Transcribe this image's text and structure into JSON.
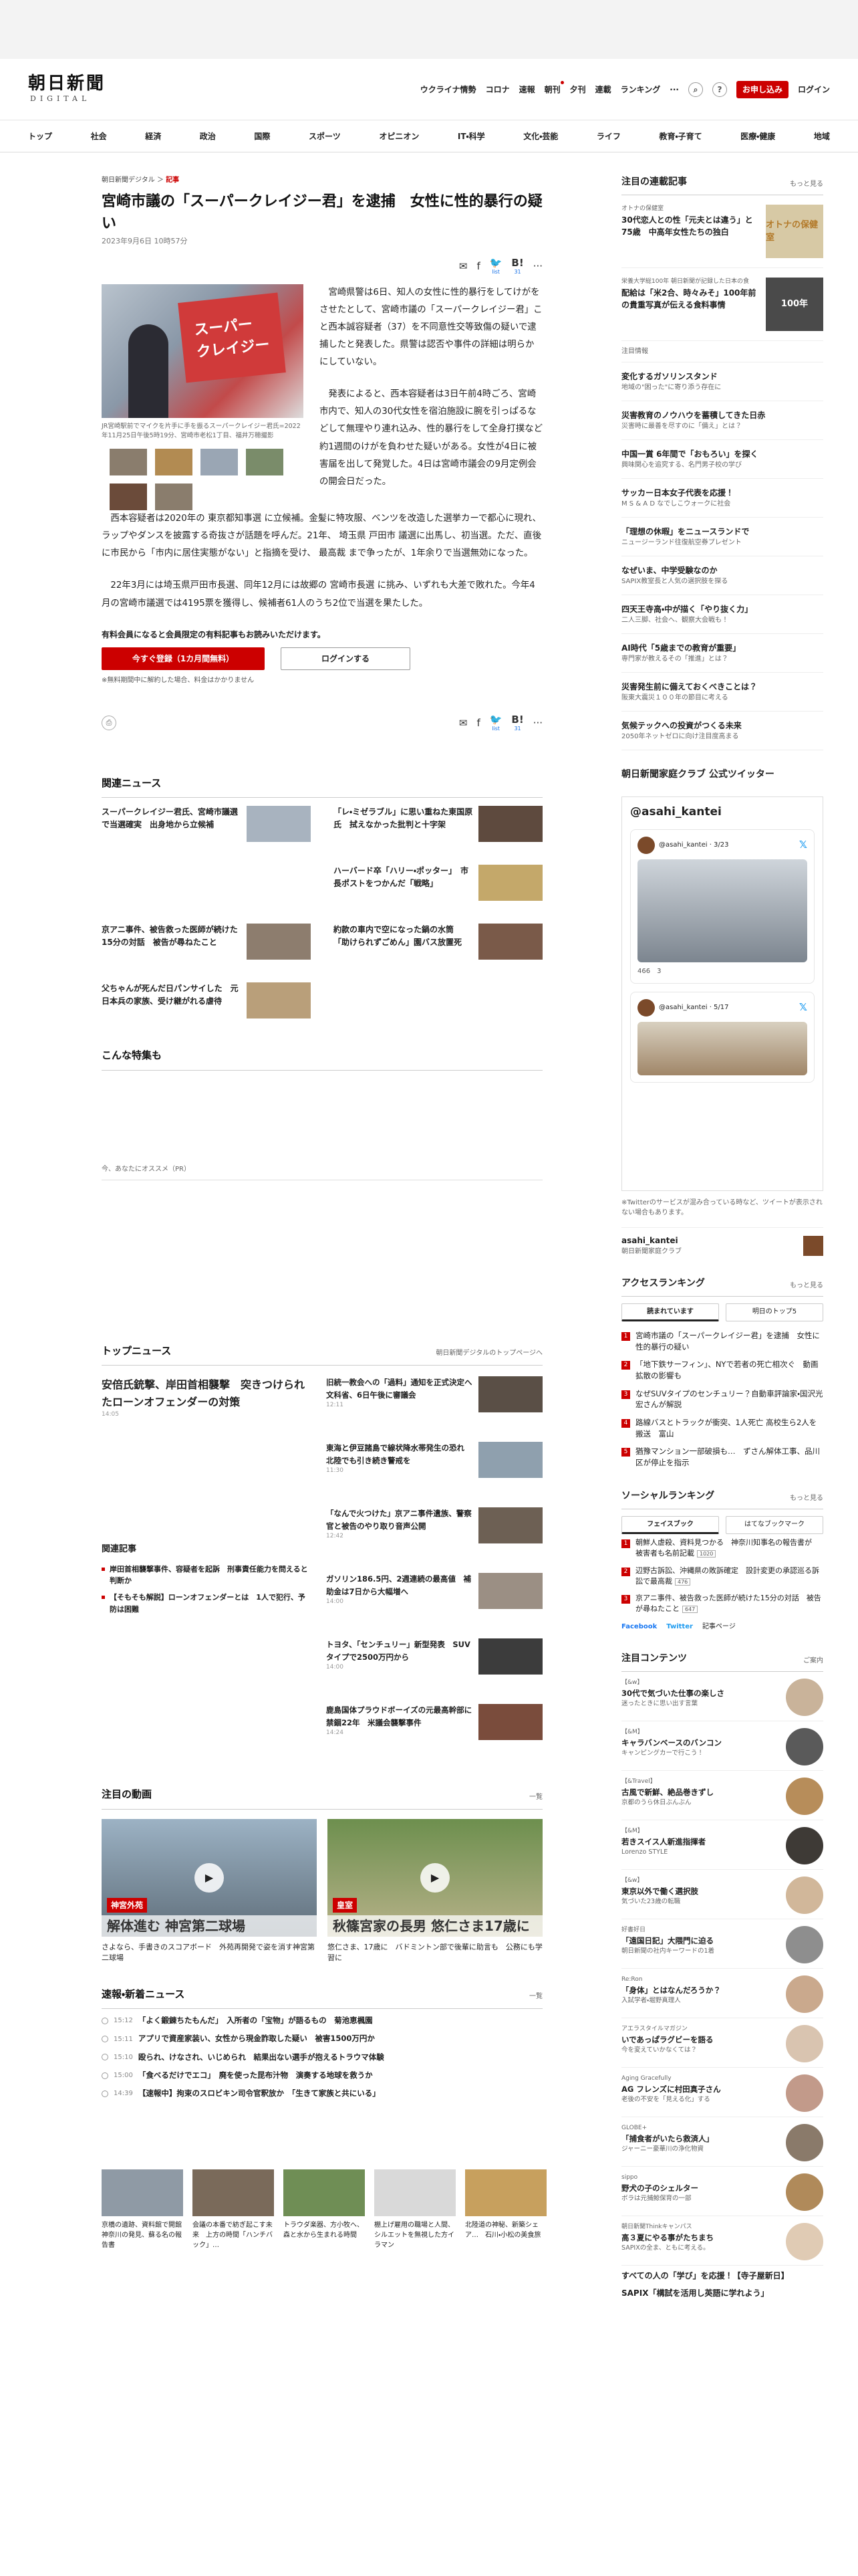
{
  "header": {
    "logo": "朝日新聞",
    "logo_sub": "DIGITAL",
    "nav": [
      "ウクライナ情勢",
      "コロナ",
      "速報",
      "朝刊",
      "夕刊",
      "連載",
      "ランキング"
    ],
    "more": "···",
    "subscribe": "お申し込み",
    "login": "ログイン"
  },
  "categories": [
    "トップ",
    "社会",
    "経済",
    "政治",
    "国際",
    "スポーツ",
    "オピニオン",
    "IT・科学",
    "文化・芸能",
    "ライフ",
    "教育・子育て",
    "医療・健康",
    "地域"
  ],
  "article": {
    "breadcrumb": [
      "朝日新聞デジタル",
      "記事"
    ],
    "title": "宮崎市議の「スーパークレイジー君」を逮捕　女性に性的暴行の疑い",
    "date": "2023年9月6日 10時57分",
    "share": {
      "list": "list",
      "count": "31"
    },
    "photo_caption": "JR宮崎駅前でマイクを片手に手を振るスーパークレイジー君氏=2022年11月25日午後5時19分、宮崎市老松1丁目、福井万穂撮影",
    "paragraphs_side": [
      "宮崎県警は6日、知人の女性に性的暴行をしてけがをさせたとして、宮崎市議の「スーパークレイジー君」こと西本誠容疑者（37）を不同意性交等致傷の疑いで逮捕したと発表した。県警は認否や事件の詳細は明らかにしていない。",
      "発表によると、西本容疑者は3日午前4時ごろ、宮崎市内で、知人の30代女性を宿泊施設に腕を引っぱるなどして無理やり連れ込み、性的暴行をして全身打撲など約1週間のけがを負わせた疑いがある。女性が4日に被害届を出して発覚した。4日は宮崎市議会の9月定例会の開会日だった。",
      "西本容疑者は2020年の 東京都知事選 に立候補。金髪に特攻服、ベンツを改造した選挙カーで都心に現れ、ラップやダンスを披露する奇抜さが話題を呼んだ。21年、 埼玉県 戸田市 議選に出馬し、初当選。ただ、直後に市民から「市内に居住実態がない」と指摘を受け、 最高裁 まで争ったが、1年余りで当選無効になった。"
    ],
    "paragraphs_full": [
      "22年3月には埼玉県戸田市長選、同年12月には故郷の 宮崎市長選 に挑み、いずれも大差で敗れた。今年4月の宮崎市議選では4195票を獲得し、候補者61人のうち2位で当選を果たした。"
    ],
    "paywall": {
      "lead": "有料会員になると会員限定の有料記事もお読みいただけます。",
      "register": "今すぐ登録（1カ月間無料）",
      "login": "ログインする",
      "note": "※無料期間中に解約した場合、料金はかかりません"
    }
  },
  "related": {
    "title": "関連ニュース",
    "items": [
      "スーパークレイジー君氏、宮崎市議選で当選確実　出身地から立候補",
      "「レ・ミゼラブル」に思い重ねた東国原氏　拭えなかった批判と十字架",
      "",
      "ハーバード卒「ハリー・ポッター」　市長ポストをつかんだ「戦略」",
      "京アニ事件、被告救った医師が続けた15分の対話　被告が尋ねたこと",
      "約款の車内で空になった鍋の水筒　「助けられずごめん」園バス放置死",
      "父ちゃんが死んだ日パンサイした　元日本兵の家族、受け継がれる虐待",
      ""
    ]
  },
  "konna": {
    "title": "こんな特集も"
  },
  "recommend": {
    "label": "今、あなたにオススメ（PR）"
  },
  "topnews": {
    "title": "トップニュース",
    "more": "朝日新聞デジタルのトップページへ",
    "lead": "安倍氏銃撃、岸田首相襲撃　突きつけられたローンオフェンダーの対策",
    "lead_time": "14:05",
    "related_title": "関連記事",
    "related": [
      "岸田首相襲撃事件、容疑者を起訴　刑事責任能力を問えると判断か",
      "【そもそも解説】ローンオフェンダーとは　1人で犯行、予防は困難"
    ],
    "items": [
      {
        "t": "旧統一教会への「過料」通知を正式決定へ　文科省、6日午後に審議会",
        "tm": "12:11"
      },
      {
        "t": "東海と伊豆諸島で線状降水帯発生の恐れ　北陸でも引き続き警戒を",
        "tm": "11:30"
      },
      {
        "t": "「なんで火つけた」京アニ事件遺族、警察官と被告のやり取り音声公開",
        "tm": "12:42"
      },
      {
        "t": "ガソリン186.5円、2週連続の最高値　補助金は7日から大幅増へ",
        "tm": "14:00"
      },
      {
        "t": "トヨタ、「センチュリー」新型発表　SUVタイプで2500万円から",
        "tm": "14:00"
      },
      {
        "t": "鹿島国体プラウドボーイズの元最高幹部に禁錮22年　米議会襲撃事件",
        "tm": "14:24"
      }
    ]
  },
  "videos": {
    "title": "注目の動画",
    "more": "一覧",
    "items": [
      {
        "tag": "神宮外苑",
        "band": "解体進む 神宮第二球場",
        "cap": "さよなら、手書きのスコアボード　外苑再開発で姿を消す神宮第二球場"
      },
      {
        "tag": "皇室",
        "band": "秋篠宮家の長男 悠仁さま17歳に",
        "cap": "悠仁さま、17歳に　バドミントン部で後輩に助言も　公務にも学習に"
      }
    ]
  },
  "breaking": {
    "title": "速報・新着ニュース",
    "more": "一覧",
    "items": [
      {
        "tm": "15:12",
        "t": "「よく鍛錬ちたもんだ」　入所者の「宝物」が語るもの　菊池恵楓園"
      },
      {
        "tm": "15:11",
        "t": "アプリで資産家装い、女性から現金詐取した疑い　被害1500万円か"
      },
      {
        "tm": "15:10",
        "t": "殴られ、けなされ、いじめられ　結果出ない選手が抱えるトラウマ体験"
      },
      {
        "tm": "15:00",
        "t": "「食べるだけでエコ」　廃を使った昆布汁物　演奏する地球を救うか"
      },
      {
        "tm": "14:39",
        "t": "【速報中】拘束のスロビキン司令官釈放か　「生きて家族と共にいる」"
      }
    ]
  },
  "bottom_cards": [
    "京橋の遺跡、資料館で開館　神奈川の発見、蘇る名の報告書",
    "会議の本番で紡ぎ起こす未来　上方の時間「ハンチバック」…",
    "トラウダ楽器、方小牧へ、森と水から生まれる時間",
    "棚上げ雇用の職場と人間、シルエットを無視した方イラマン",
    "北陸道の神秘、新築シェア…　石川・小松の美食旅"
  ],
  "sidebar": {
    "serial": {
      "title": "注目の連載記事",
      "more": "もっと見る",
      "items": [
        {
          "pre": "オトナの保健室",
          "t": "30代恋人との性「元夫とは違う」と75歳　中高年女性たちの独白",
          "badge": "オトナの保健室"
        },
        {
          "pre": "栄養大学総100年 朝日新聞が記録した日本の食",
          "t": "配給は「米2合、時々みそ」100年前の貴重写真が伝える食料事情",
          "badge": "100年"
        }
      ],
      "pr": "注目情報",
      "text_items": [
        {
          "t": "変化するガソリンスタンド",
          "d": "地域の\"困った\"に寄り添う存在に"
        },
        {
          "t": "災害教育のノウハウを蓄積してきた日赤",
          "d": "災害時に最善を尽すのに「備え」とは？"
        },
        {
          "t": "中国一賞 6年間で「おもろい」を探く",
          "d": "興味関心を追究する、名門男子校の学び"
        },
        {
          "t": "サッカー日本女子代表を応援！",
          "d": "M S & A D なでしこウォークに社会"
        },
        {
          "t": "「理想の休暇」をニュースランドで",
          "d": "ニュージーランド往復航空券プレゼント"
        },
        {
          "t": "なぜいま、中学受験なのか",
          "d": "SAPIX教室長と人気の選択肢を探る"
        },
        {
          "t": "四天王寺高・中が描く「やり抜く力」",
          "d": "二人三脚、社会へ、観察大会戦も！"
        },
        {
          "t": "AI時代「5歳までの教育が重要」",
          "d": "専門家が教えるその「推進」とは？"
        },
        {
          "t": "災害発生前に備えておくべきことは？",
          "d": "阪東大震災１００年の節目に考える"
        },
        {
          "t": "気候テックへの投資がつくる未来",
          "d": "2050年ネットゼロに向け注目度高まる"
        }
      ]
    },
    "twitter": {
      "title": "朝日新聞家庭クラブ 公式ツイッター",
      "handle": "@asahi_kantei",
      "tweet1_meta": "@asahi_kantei · 3/23",
      "tweet1_stats": "466　3",
      "tweet2_meta": "@asahi_kantei · 5/17",
      "note": "※Twitterのサービスが混み合っている時など、ツイートが表示されない場合もあります。",
      "foot_name": "asahi_kantei",
      "foot_sub": "朝日新聞家庭クラブ"
    },
    "access": {
      "title": "アクセスランキング",
      "more": "もっと見る",
      "tabs": [
        "読まれています",
        "明日のトップ5"
      ],
      "items": [
        "宮崎市議の「スーパークレイジー君」を逮捕　女性に性的暴行の疑い",
        "「地下鉄サーフィン」、NYで若者の死亡相次ぐ　動画拡散の影響も",
        "なぜSUVタイプのセンチュリー？自動車評論家・国沢光宏さんが解説",
        "路線バスとトラックが衝突、1人死亡 高校生ら2人を搬送　富山",
        "猶豫マンション一部破損も…　ずさん解体工事、品川区が停止を指示"
      ]
    },
    "social": {
      "title": "ソーシャルランキング",
      "more": "もっと見る",
      "tabs": [
        "フェイスブック",
        "はてなブックマーク"
      ],
      "items": [
        {
          "t": "朝鮮人虐殺、資料見つかる　神奈川知事名の報告書が　被害者も名前記載",
          "c": "1020"
        },
        {
          "t": "辺野古訴訟、沖縄県の敗訴確定　設計変更の承認巡る訴訟で最高裁",
          "c": "476"
        },
        {
          "t": "京アニ事件、被告救った医師が続けた15分の対話　被告が尋ねたこと",
          "c": "647"
        }
      ],
      "fb": "Facebook",
      "tw": "Twitter",
      "rank_more": "記事ページ"
    },
    "contents": {
      "title": "注目コンテンツ",
      "more": "ご案内",
      "items": [
        {
          "pre": "【&w】",
          "t": "30代で気づいた仕事の楽しさ",
          "d": "迷ったときに思い出す言葉"
        },
        {
          "pre": "【&M】",
          "t": "キャラバンベースのバンコン",
          "d": "キャンピングカーで行こう！"
        },
        {
          "pre": "【&Travel】",
          "t": "古風で新鮮、絶品巻きずし",
          "d": "京都のうら休日ぶんぶん"
        },
        {
          "pre": "【&M】",
          "t": "若きスイス人新進指揮者",
          "d": "Lorenzo STYLE"
        },
        {
          "pre": "【&w】",
          "t": "東京以外で働く選択肢",
          "d": "気づいた23歳の転職"
        },
        {
          "pre": "好書好日",
          "t": "「遠国日記」大隈門に迫る",
          "d": "朝日新聞の社内キーワードの1着"
        },
        {
          "pre": "Re:Ron",
          "t": "「身体」とはなんだろうか？",
          "d": "入試学者・堀野真理人"
        },
        {
          "pre": "アエラスタイルマガジン",
          "t": "いであっぱラグビーを語る",
          "d": "今を変えていかなくては？"
        },
        {
          "pre": "Aging Gracefully",
          "t": "AG フレンズに村田真子さん",
          "d": "老後の不安を「見える化」する"
        },
        {
          "pre": "GLOBE+",
          "t": "「捕食者がいたら救済人」",
          "d": "ジャーニー豪華川の浄化物資"
        },
        {
          "pre": "sippo",
          "t": "野犬の子のシェルター",
          "d": "ボラは元捕鯨保育の一部"
        },
        {
          "pre": "朝日新聞Thinkキャンパス",
          "t": "高３夏にやる事がたちまち",
          "d": "SAPIXの全ま、ともに考える。"
        }
      ],
      "footer_lines": [
        "すべての人の「学び」を応援！【寺子屋新日】",
        "SAPIX「構試を活用し英語に学れよう」"
      ]
    }
  }
}
